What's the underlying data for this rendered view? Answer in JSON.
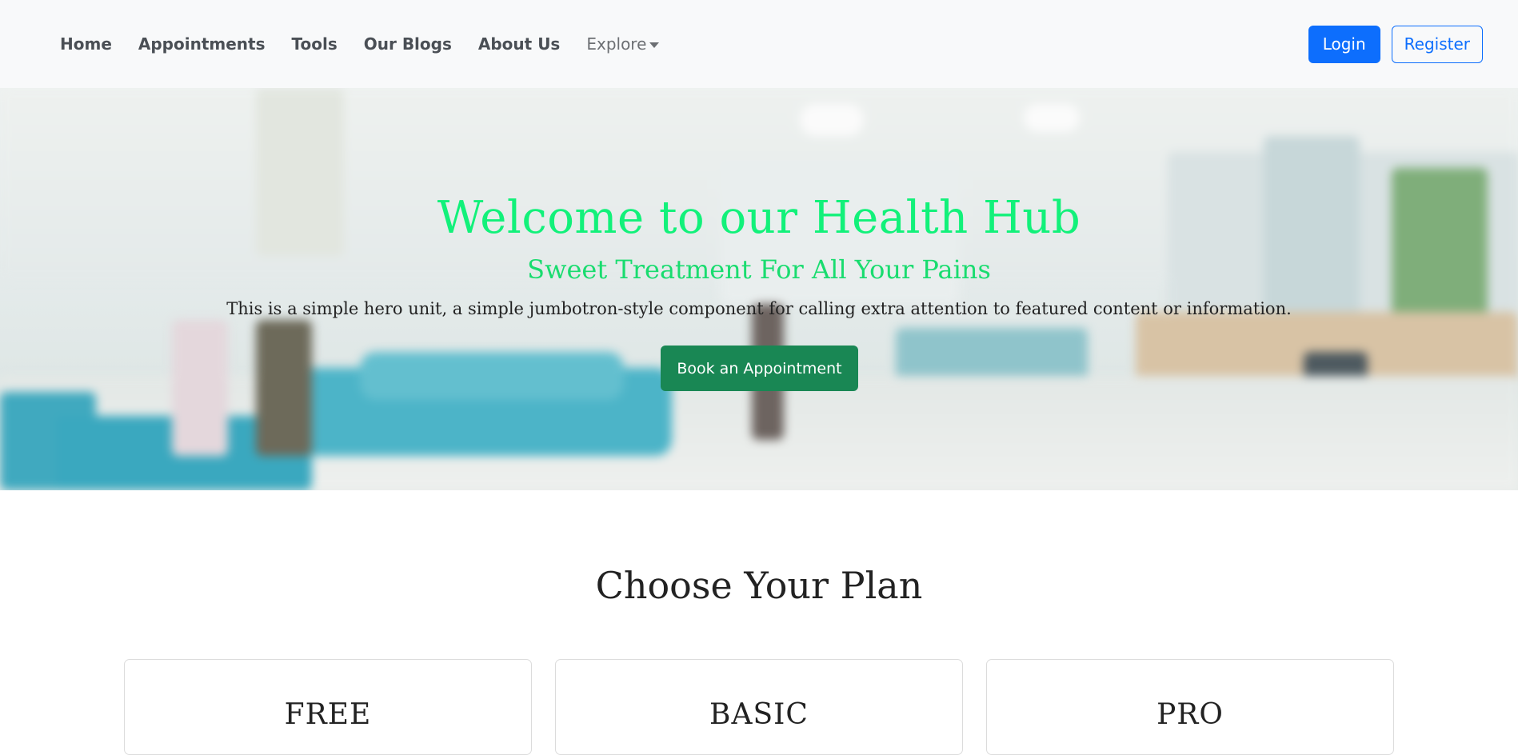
{
  "nav": {
    "links": [
      "Home",
      "Appointments",
      "Tools",
      "Our Blogs",
      "About Us"
    ],
    "dropdown_label": "Explore",
    "login_label": "Login",
    "register_label": "Register"
  },
  "hero": {
    "title": "Welcome to our Health Hub",
    "subtitle": "Sweet Treatment For All Your Pains",
    "text": "This is a simple hero unit, a simple jumbotron-style component for calling extra attention to featured content or information.",
    "cta_label": "Book an Appointment"
  },
  "plans": {
    "title": "Choose Your Plan",
    "items": [
      "FREE",
      "BASIC",
      "PRO"
    ]
  },
  "colors": {
    "primary": "#0d6efd",
    "success": "#198754",
    "hero_title": "#12f17a",
    "navbar_bg": "#f8f9fa"
  }
}
